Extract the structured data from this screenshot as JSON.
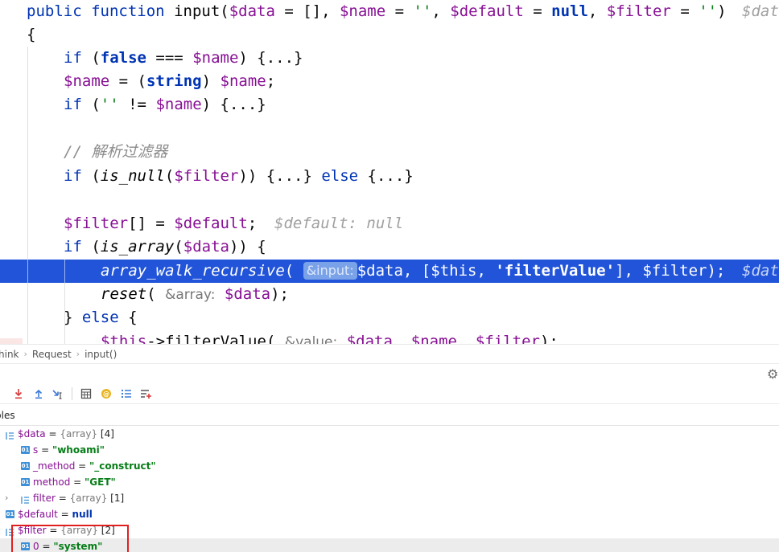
{
  "editor": {
    "lines": {
      "l1": {
        "kw1": "public",
        "kw2": "function",
        "name": "input(",
        "p1": "$data",
        "p1rest": " = [], ",
        "p2": "$name",
        "p2eq": " = ",
        "p2v": "''",
        "comma2": ", ",
        "p3": "$default",
        "p3eq": " = ",
        "p3v": "null",
        "comma3": ", ",
        "p4": "$filter",
        "p4eq": " = ",
        "p4v": "''",
        "close": ")",
        "hint": "$dat"
      },
      "l2": {
        "brace": "{"
      },
      "l3": {
        "kw": "if",
        "open": " (",
        "kw2": "false",
        "mid": " === ",
        "var": "$name",
        "rest": ") {...}"
      },
      "l4": {
        "var": "$name",
        "mid": " = (",
        "cast": "string",
        "close": ") ",
        "var2": "$name",
        "end": ";"
      },
      "l5": {
        "kw": "if",
        "open": " (",
        "str": "''",
        "mid": " != ",
        "var": "$name",
        "rest": ") {...}"
      },
      "l6": {
        "comment": "// 解析过滤器"
      },
      "l7": {
        "kw": "if",
        "open": " (",
        "fn": "is_null",
        "p": "(",
        "var": "$filter",
        "rest": ")) {...} ",
        "kw2": "else",
        "rest2": " {...}"
      },
      "l8": {
        "var": "$filter",
        "mid": "[] = ",
        "var2": "$default",
        "end": ";",
        "hint": "$default: null"
      },
      "l9": {
        "kw": "if",
        "open": " (",
        "fn": "is_array",
        "p": "(",
        "var": "$data",
        "rest": ")) {"
      },
      "l10": {
        "fn": "array_walk_recursive",
        "p": "(",
        "inlay": "&input:",
        "var": "$data",
        "mid": ", [",
        "var2": "$this",
        "mid2": ", ",
        "str": "'filterValue'",
        "mid3": "], ",
        "var3": "$filter",
        "end": ");",
        "hint": "$dat"
      },
      "l11": {
        "fn": "reset",
        "p": "( ",
        "inlay": "&array:",
        "var": "$data",
        "end": ");"
      },
      "l12": {
        "brace": "} ",
        "kw": "else",
        "rest": " {"
      },
      "l13": {
        "var": "$this",
        "arrow": "->",
        "fn": "filterValue",
        "p": "( ",
        "inlay": "&value:",
        "var2": "$data",
        "m": ", ",
        "var3": "$name",
        "m2": ", ",
        "var4": "$filter",
        "end": ");"
      }
    }
  },
  "breadcrumb": [
    "hink",
    "Request",
    "input()"
  ],
  "panel": {
    "tab": "bles",
    "vars": [
      {
        "name": "$data",
        "eq": " = ",
        "type": "{array}",
        "count": " [4]"
      },
      {
        "name": "s",
        "eq": " = ",
        "value": "\"whoami\""
      },
      {
        "name": "_method",
        "eq": " = ",
        "value": "\"_construct\""
      },
      {
        "name": "method",
        "eq": " = ",
        "value": "\"GET\""
      },
      {
        "name": "filter",
        "eq": " = ",
        "type": "{array}",
        "count": " [1]"
      },
      {
        "name": "$default",
        "eq": " = ",
        "value": "null"
      },
      {
        "name": "$filter",
        "eq": " = ",
        "type": "{array}",
        "count": " [2]"
      },
      {
        "name": "0",
        "eq": " = ",
        "value": "\"system\""
      }
    ]
  },
  "colors": {
    "execution_line": "#2154d8",
    "highlight_box": "#e02020"
  }
}
